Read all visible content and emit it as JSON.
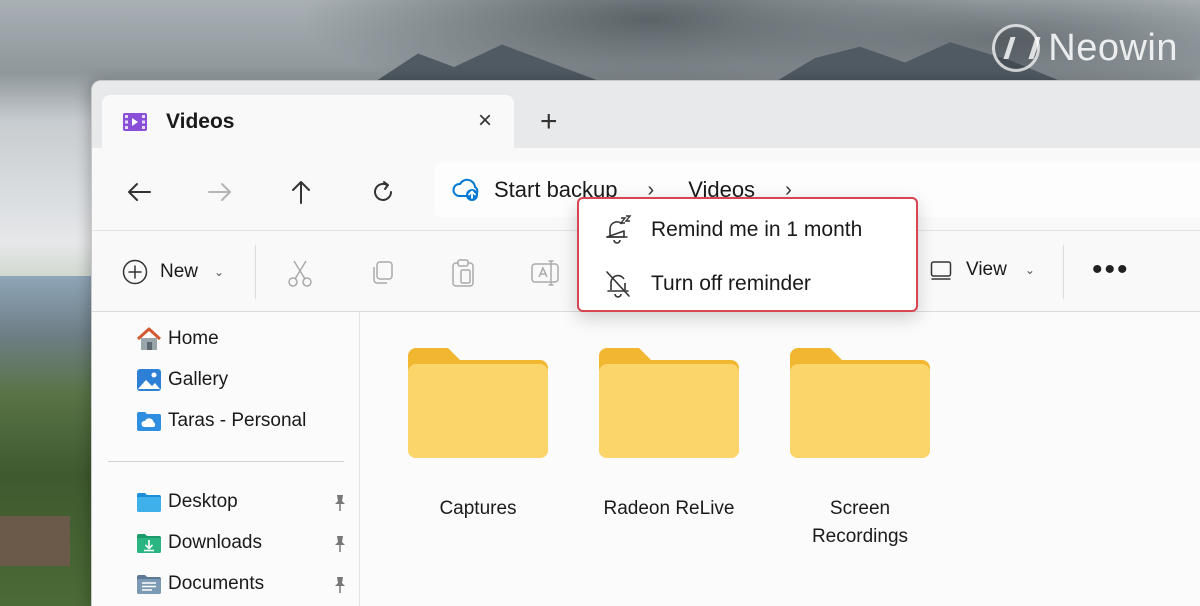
{
  "watermark": {
    "brand": "Neowin"
  },
  "tab": {
    "title": "Videos",
    "close": "×",
    "new_tab": "+"
  },
  "address": {
    "crumbs": [
      "Start backup",
      "Videos"
    ],
    "separator": "›"
  },
  "toolbar": {
    "new_label": "New",
    "view_label": "View",
    "more_label": "•••",
    "caret": "⌄"
  },
  "popup": {
    "items": [
      {
        "label": "Remind me in 1 month",
        "icon": "bell-snooze-icon"
      },
      {
        "label": "Turn off reminder",
        "icon": "bell-off-icon"
      }
    ]
  },
  "sidebar": {
    "items": [
      {
        "label": "Home",
        "icon": "home-icon",
        "pinned": false
      },
      {
        "label": "Gallery",
        "icon": "gallery-icon",
        "pinned": false
      },
      {
        "label": "Taras - Personal",
        "icon": "onedrive-folder-icon",
        "pinned": false
      },
      {
        "label": "Desktop",
        "icon": "desktop-folder-icon",
        "pinned": true
      },
      {
        "label": "Downloads",
        "icon": "downloads-folder-icon",
        "pinned": true
      },
      {
        "label": "Documents",
        "icon": "documents-folder-icon",
        "pinned": true
      }
    ]
  },
  "folders": [
    {
      "name": "Captures"
    },
    {
      "name": "Radeon ReLive"
    },
    {
      "name": "Screen Recordings"
    }
  ],
  "colors": {
    "highlight": "#d64550",
    "folder": "#f8c94a",
    "accent": "#0078d4"
  }
}
